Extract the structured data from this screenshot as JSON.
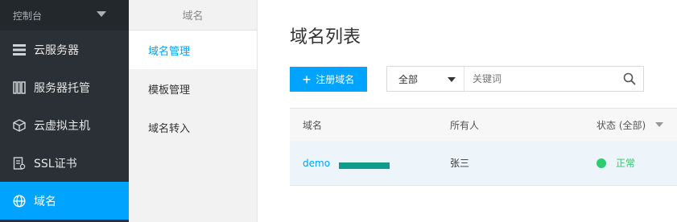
{
  "sidebar": {
    "console_label": "控制台",
    "items": [
      {
        "label": "云服务器",
        "icon": "server-list-icon"
      },
      {
        "label": "服务器托管",
        "icon": "rack-icon"
      },
      {
        "label": "云虚拟主机",
        "icon": "cube-icon"
      },
      {
        "label": "SSL证书",
        "icon": "certificate-icon"
      },
      {
        "label": "域名",
        "icon": "globe-icon",
        "active": true
      }
    ]
  },
  "submenu": {
    "title": "域名",
    "items": [
      {
        "label": "域名管理",
        "active": true
      },
      {
        "label": "模板管理"
      },
      {
        "label": "域名转入"
      }
    ]
  },
  "main": {
    "title": "域名列表",
    "register_button": "注册域名",
    "search": {
      "scope": "全部",
      "placeholder": "关键词"
    },
    "table": {
      "headers": [
        "域名",
        "所有人",
        "状态 (全部)"
      ],
      "rows": [
        {
          "domain": "demo",
          "owner": "张三",
          "status": "正常"
        }
      ]
    }
  },
  "colors": {
    "accent": "#00a4ff",
    "sidebar_bg": "#2a3036",
    "status_ok": "#2ecc71",
    "redaction": "#0f9b8e"
  }
}
